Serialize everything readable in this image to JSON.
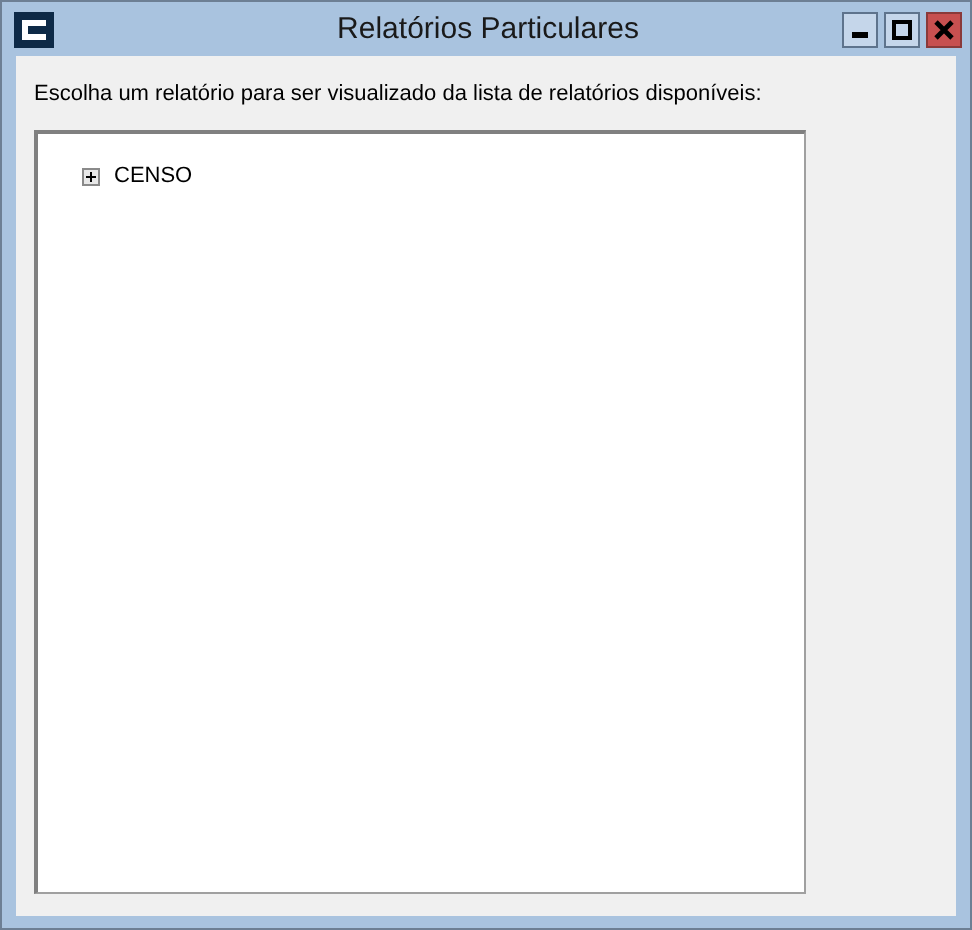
{
  "window": {
    "title": "Relatórios Particulares"
  },
  "instruction": "Escolha um relatório para ser visualizado da lista de relatórios disponíveis:",
  "tree": {
    "items": [
      {
        "label": "CENSO",
        "expanded": false
      }
    ]
  }
}
